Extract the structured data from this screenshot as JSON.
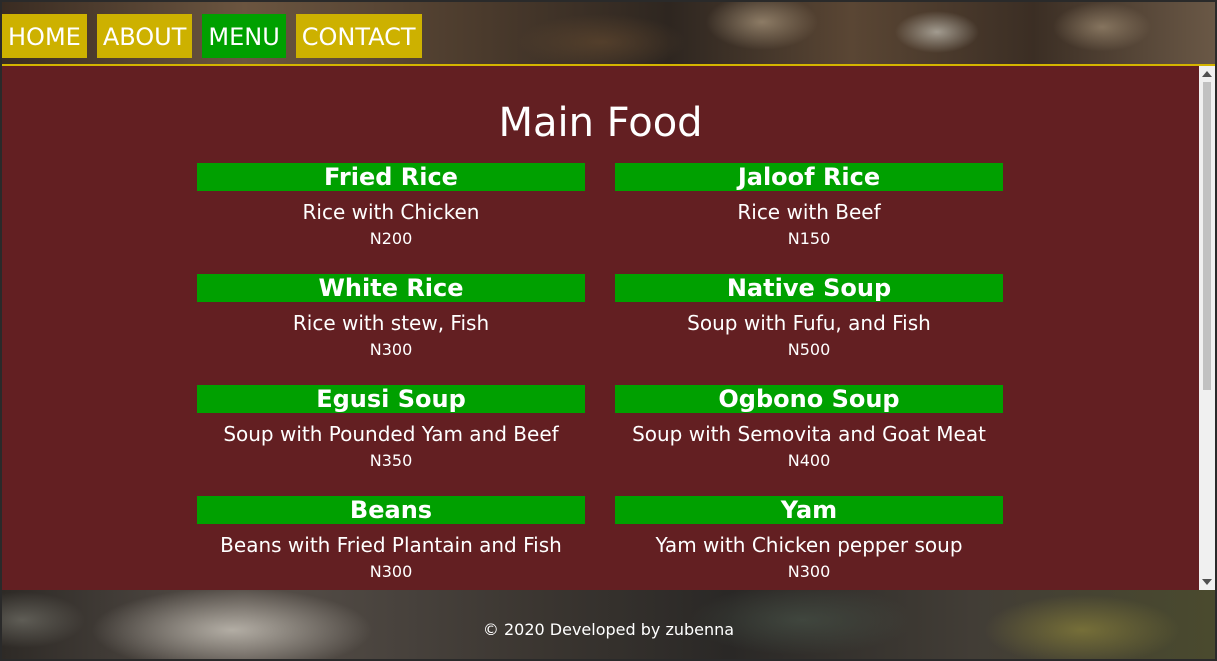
{
  "nav": {
    "items": [
      {
        "label": "HOME"
      },
      {
        "label": "ABOUT"
      },
      {
        "label": "MENU",
        "active": true
      },
      {
        "label": "CONTACT"
      }
    ]
  },
  "main": {
    "title": "Main Food",
    "items": [
      {
        "name": "Fried Rice",
        "desc": "Rice with Chicken",
        "price": "N200"
      },
      {
        "name": "Jaloof Rice",
        "desc": "Rice with Beef",
        "price": "N150"
      },
      {
        "name": "White Rice",
        "desc": "Rice with stew, Fish",
        "price": "N300"
      },
      {
        "name": "Native Soup",
        "desc": "Soup with Fufu, and Fish",
        "price": "N500"
      },
      {
        "name": "Egusi Soup",
        "desc": "Soup with Pounded Yam and Beef",
        "price": "N350"
      },
      {
        "name": "Ogbono Soup",
        "desc": "Soup with Semovita and Goat Meat",
        "price": "N400"
      },
      {
        "name": "Beans",
        "desc": "Beans with Fried Plantain and Fish",
        "price": "N300"
      },
      {
        "name": "Yam",
        "desc": "Yam with Chicken pepper soup",
        "price": "N300"
      }
    ]
  },
  "footer": {
    "text": "© 2020 Developed by zubenna"
  },
  "colors": {
    "nav_bg": "#cdb100",
    "nav_active": "#00a000",
    "main_bg": "#631f22",
    "card_header": "#00a000"
  }
}
